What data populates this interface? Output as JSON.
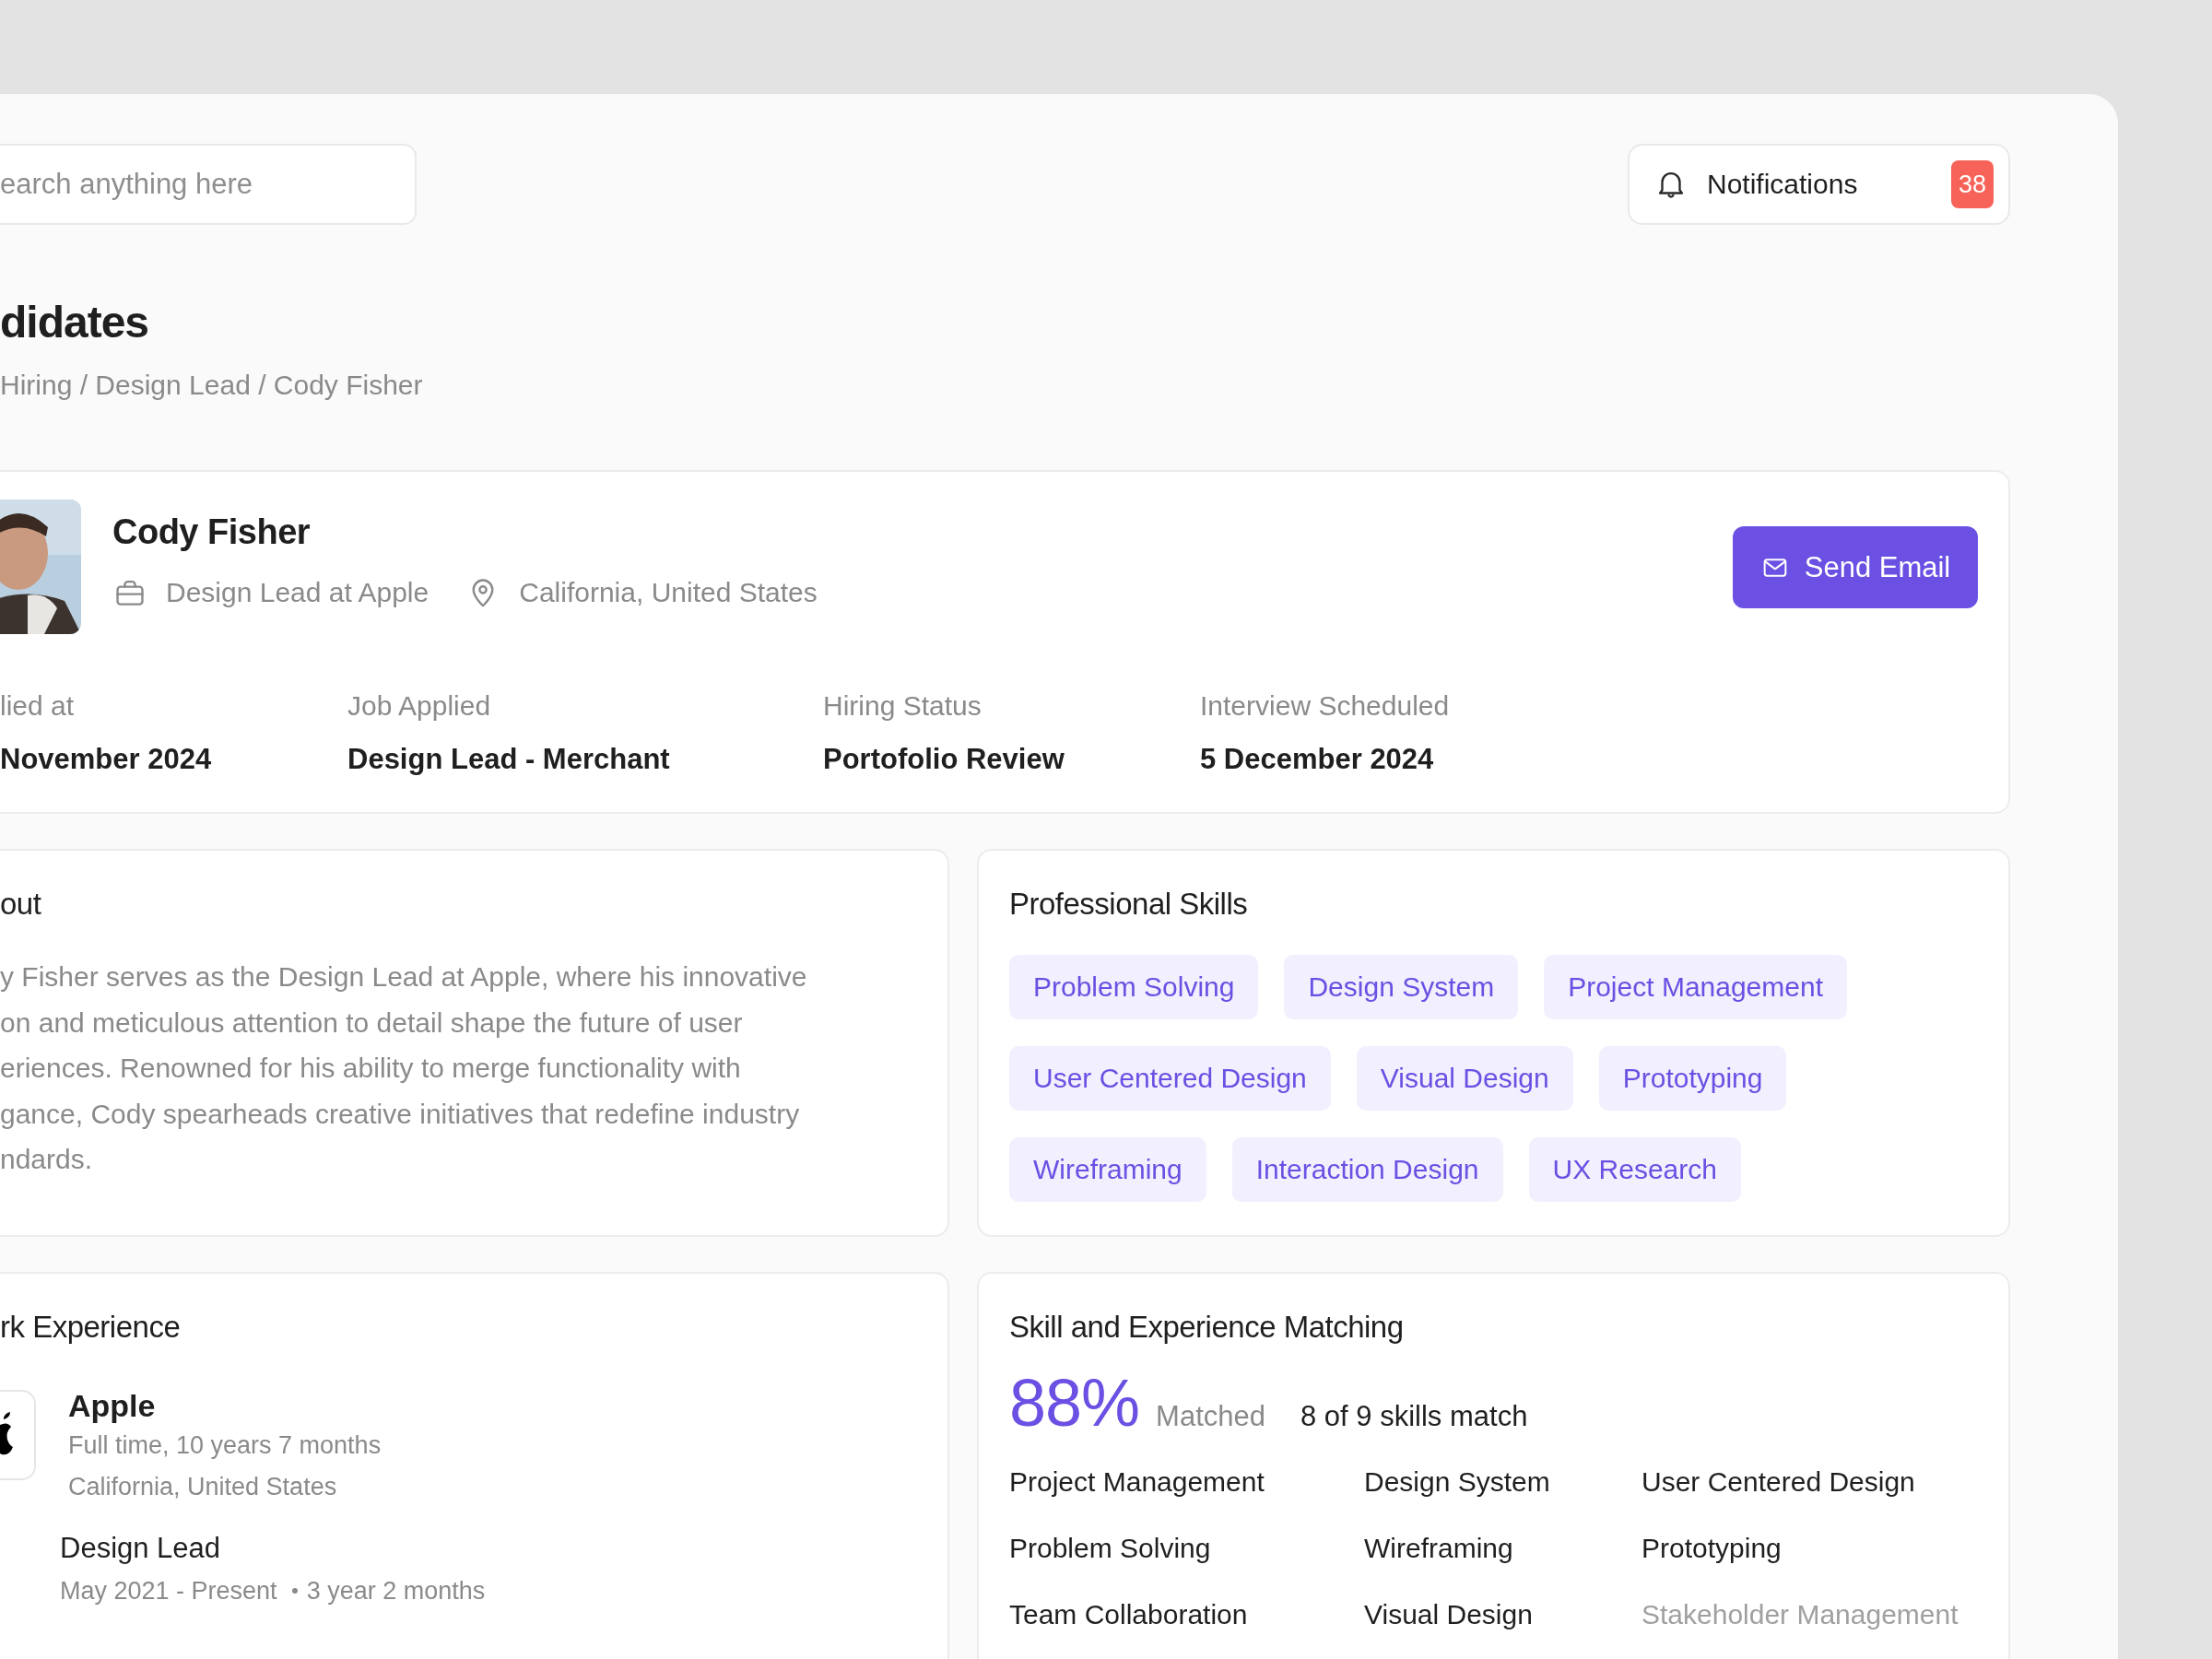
{
  "search": {
    "placeholder": "earch anything here"
  },
  "notifications": {
    "label": "Notifications",
    "count": "38"
  },
  "page_title": "didates",
  "breadcrumb": "Hiring / Design Lead / Cody Fisher",
  "candidate": {
    "name": "Cody Fisher",
    "role": "Design Lead at Apple",
    "location": "California, United States",
    "action": "Send Email",
    "details": [
      {
        "label": "lied at",
        "value": "November 2024"
      },
      {
        "label": "Job Applied",
        "value": "Design Lead - Merchant"
      },
      {
        "label": "Hiring Status",
        "value": "Portofolio Review"
      },
      {
        "label": "Interview Scheduled",
        "value": "5 December 2024"
      }
    ]
  },
  "about": {
    "title": "out",
    "lines": [
      "y Fisher serves as the Design Lead at Apple, where his innovative",
      "on and meticulous attention to detail shape the future of user",
      "eriences. Renowned for his ability to merge functionality with",
      "gance, Cody spearheads creative initiatives that redefine industry",
      "ndards."
    ]
  },
  "skills": {
    "title": "Professional Skills",
    "tags": [
      "Problem Solving",
      "Design System",
      "Project Management",
      "User Centered Design",
      "Visual Design",
      "Prototyping",
      "Wireframing",
      "Interaction Design",
      "UX Research"
    ]
  },
  "experience": {
    "title": "rk Experience",
    "company": "Apple",
    "type": "Full time, 10 years 7 months",
    "location": "California, United States",
    "position": "Design Lead",
    "period": "May 2021 - Present",
    "duration": "3 year 2 months"
  },
  "matching": {
    "title": "Skill and Experience Matching",
    "percent": "88%",
    "percent_label": "Matched",
    "summary": "8 of 9 skills match",
    "skills": [
      {
        "name": "Project Management",
        "matched": true
      },
      {
        "name": "Design System",
        "matched": true
      },
      {
        "name": "User Centered Design",
        "matched": true
      },
      {
        "name": "Problem Solving",
        "matched": true
      },
      {
        "name": "Wireframing",
        "matched": true
      },
      {
        "name": "Prototyping",
        "matched": true
      },
      {
        "name": "Team Collaboration",
        "matched": true
      },
      {
        "name": "Visual Design",
        "matched": true
      },
      {
        "name": "Stakeholder Management",
        "matched": false
      }
    ]
  }
}
